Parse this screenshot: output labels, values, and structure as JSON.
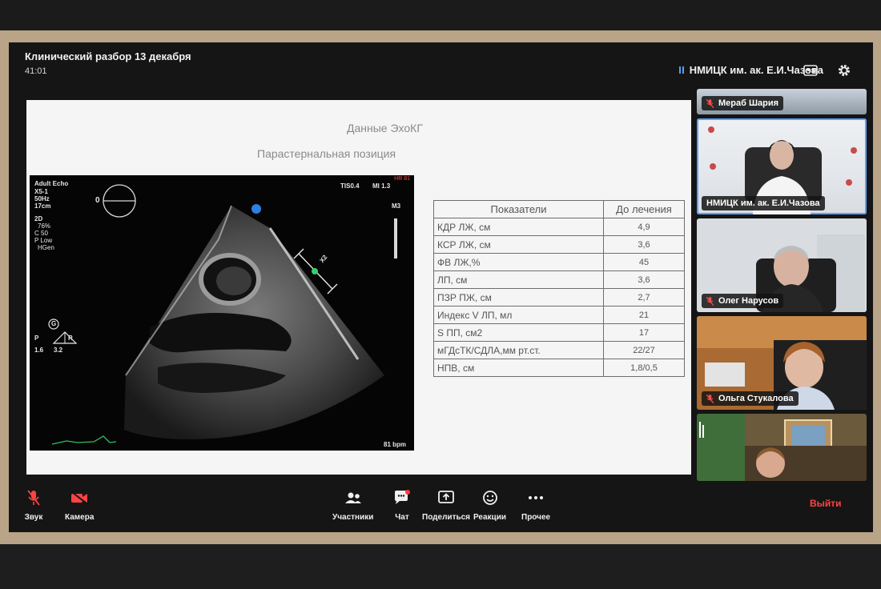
{
  "window": {
    "title": "Клинический разбор 13 декабря",
    "timer": "41:01",
    "organization": "НМИЦК им. ак. Е.И.Чазова"
  },
  "slide": {
    "title": "Данные ЭхоКГ",
    "subtitle": "Парастернальная позиция",
    "echo": {
      "mode": "Adult Echo",
      "probe": "X5-1",
      "freq": "50Hz",
      "depth": "17cm",
      "mode2d": "2D",
      "gain": "76%",
      "compress": "C 50",
      "power": "P Low",
      "hgen": "HGen",
      "tis": "TIS0.4",
      "mi": "MI 1.3",
      "hr": "HR 81",
      "m3": "M3",
      "bpm": "81 bpm",
      "marker_zero": "0",
      "g": "G",
      "p": "P",
      "r": "R",
      "val1": "1.6",
      "val2": "3.2",
      "x2": "X2"
    },
    "table": {
      "headers": [
        "Показатели",
        "До лечения"
      ],
      "rows": [
        [
          "КДР ЛЖ, см",
          "4,9"
        ],
        [
          "КСР ЛЖ, см",
          "3,6"
        ],
        [
          "ФВ ЛЖ,%",
          "45"
        ],
        [
          "ЛП, см",
          "3,6"
        ],
        [
          "ПЗР ПЖ, см",
          "2,7"
        ],
        [
          "Индекс V ЛП, мл",
          "21"
        ],
        [
          "S ПП, см2",
          "17"
        ],
        [
          "мГДсТК/СДЛА,мм рт.ст.",
          "22/27"
        ],
        [
          "НПВ, см",
          "1,8/0,5"
        ]
      ]
    }
  },
  "participants": [
    {
      "name": "Мераб Шария",
      "muted": true
    },
    {
      "name": "НМИЦК им. ак. Е.И.Чазова",
      "muted": false
    },
    {
      "name": "Олег Нарусов",
      "muted": true
    },
    {
      "name": "Ольга Стукалова",
      "muted": true
    },
    {
      "name": "",
      "muted": false
    }
  ],
  "toolbar": {
    "sound": "Звук",
    "camera": "Камера",
    "participants": "Участники",
    "chat": "Чат",
    "share": "Поделиться",
    "reactions": "Реакции",
    "more": "Прочее",
    "exit": "Выйти"
  },
  "colors": {
    "accent": "#5aa3ff",
    "danger": "#ff4343",
    "screen_bg": "#151515"
  }
}
